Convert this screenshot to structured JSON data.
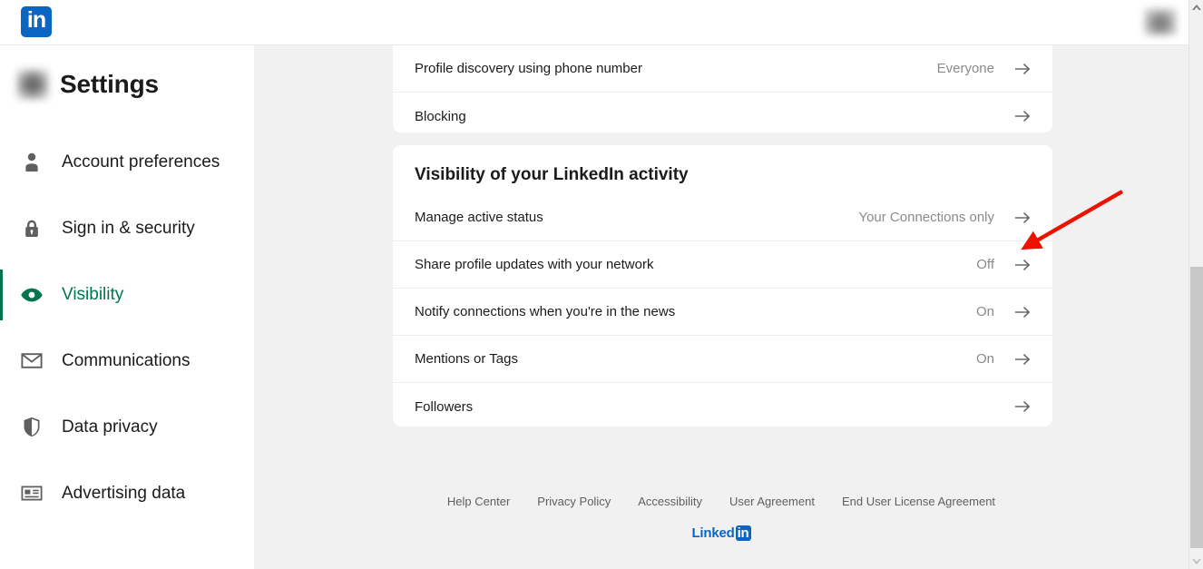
{
  "app": {
    "brand_name": "LinkedIn",
    "logo_text": "in",
    "brand_color": "#0a66c2",
    "accent_green": "#01754f"
  },
  "header": {
    "logo_icon": "linkedin-logo-icon",
    "avatar_icon": "user-avatar-icon"
  },
  "sidebar": {
    "title": "Settings",
    "avatar_icon": "profile-avatar-icon",
    "items": [
      {
        "label": "Account preferences",
        "icon": "person-icon",
        "active": false
      },
      {
        "label": "Sign in & security",
        "icon": "lock-icon",
        "active": false
      },
      {
        "label": "Visibility",
        "icon": "eye-icon",
        "active": true
      },
      {
        "label": "Communications",
        "icon": "envelope-icon",
        "active": false
      },
      {
        "label": "Data privacy",
        "icon": "shield-icon",
        "active": false
      },
      {
        "label": "Advertising data",
        "icon": "ad-card-icon",
        "active": false
      }
    ]
  },
  "main": {
    "cards": [
      {
        "title": "",
        "rows": [
          {
            "label": "Profile discovery using phone number",
            "value": "Everyone",
            "arrow": "arrow-right-icon"
          },
          {
            "label": "Blocking",
            "value": "",
            "arrow": "arrow-right-icon"
          }
        ]
      },
      {
        "title": "Visibility of your LinkedIn activity",
        "rows": [
          {
            "label": "Manage active status",
            "value": "Your Connections only",
            "arrow": "arrow-right-icon"
          },
          {
            "label": "Share profile updates with your network",
            "value": "Off",
            "arrow": "arrow-right-icon"
          },
          {
            "label": "Notify connections when you're in the news",
            "value": "On",
            "arrow": "arrow-right-icon"
          },
          {
            "label": "Mentions or Tags",
            "value": "On",
            "arrow": "arrow-right-icon"
          },
          {
            "label": "Followers",
            "value": "",
            "arrow": "arrow-right-icon"
          }
        ]
      }
    ]
  },
  "footer": {
    "links": [
      "Help Center",
      "Privacy Policy",
      "Accessibility",
      "User Agreement",
      "End User License Agreement"
    ],
    "brand_word": "Linked",
    "brand_badge": "in"
  },
  "scrollbar": {
    "up_icon": "chevron-up-icon",
    "down_icon": "chevron-down-icon",
    "thumb_name": "scrollbar-thumb"
  },
  "annotation": {
    "color": "#ee1100",
    "target_row_label": "Share profile updates with your network"
  }
}
